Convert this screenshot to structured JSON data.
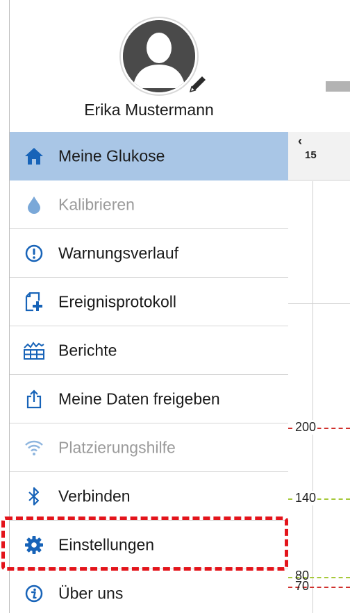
{
  "profile": {
    "name": "Erika Mustermann",
    "avatar_icon": "person-silhouette-icon",
    "edit_icon": "pencil-icon"
  },
  "menu": {
    "items": [
      {
        "label": "Meine Glukose",
        "icon": "home-icon",
        "active": true,
        "enabled": true
      },
      {
        "label": "Kalibrieren",
        "icon": "blood-drop-icon",
        "active": false,
        "enabled": false
      },
      {
        "label": "Warnungsverlauf",
        "icon": "alert-circle-icon",
        "active": false,
        "enabled": true
      },
      {
        "label": "Ereignisprotokoll",
        "icon": "add-document-icon",
        "active": false,
        "enabled": true
      },
      {
        "label": "Berichte",
        "icon": "report-chart-icon",
        "active": false,
        "enabled": true
      },
      {
        "label": "Meine Daten freigeben",
        "icon": "share-icon",
        "active": false,
        "enabled": true
      },
      {
        "label": "Platzierungshilfe",
        "icon": "signal-icon",
        "active": false,
        "enabled": false
      },
      {
        "label": "Verbinden",
        "icon": "bluetooth-icon",
        "active": false,
        "enabled": true
      },
      {
        "label": "Einstellungen",
        "icon": "gear-icon",
        "active": false,
        "enabled": true,
        "highlighted": true
      },
      {
        "label": "Über uns",
        "icon": "info-icon",
        "active": false,
        "enabled": true
      }
    ]
  },
  "chart": {
    "day": "15",
    "prev_icon": "chevron-left-icon",
    "y_labels": {
      "high": "200",
      "target": "140",
      "low_target": "80",
      "low": "70"
    }
  },
  "colors": {
    "active_bg": "#a9c6e6",
    "icon_blue": "#1763b8",
    "highlight_red": "#e3141b",
    "threshold_red": "#d0312d",
    "threshold_green": "#a6c93a"
  }
}
